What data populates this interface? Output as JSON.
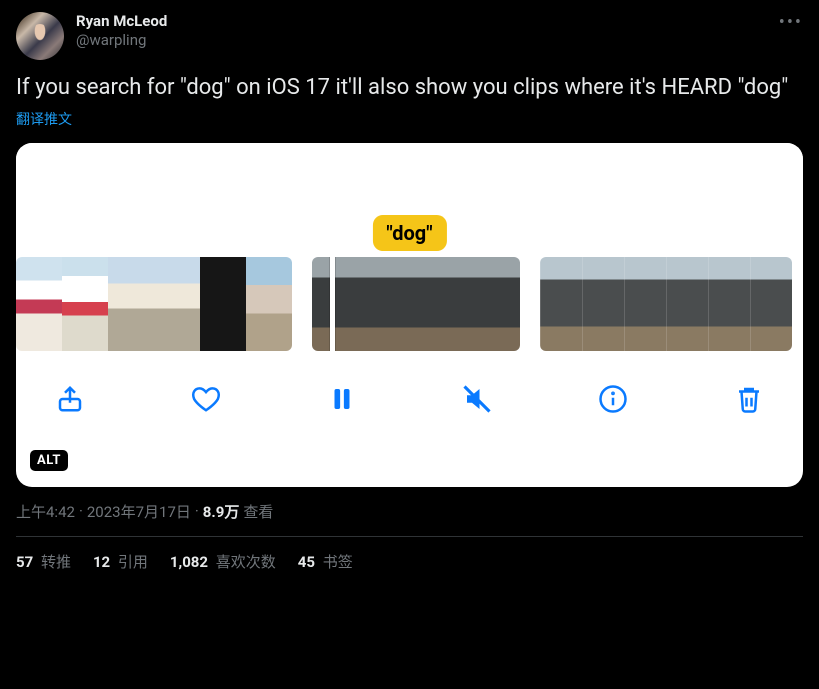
{
  "author": {
    "display_name": "Ryan McLeod",
    "handle": "@warpling"
  },
  "text": "If you search for \"dog\" on iOS 17 it'll also show you clips where it's HEARD \"dog\"",
  "translate_label": "翻译推文",
  "media": {
    "caption_badge": "\"dog\"",
    "alt_badge": "ALT"
  },
  "meta": {
    "time": "上午4:42",
    "sep": " · ",
    "date": "2023年7月17日",
    "views_count": "8.9万",
    "views_label": " 查看"
  },
  "stats": {
    "retweets": {
      "count": "57",
      "label": " 转推"
    },
    "quotes": {
      "count": "12",
      "label": " 引用"
    },
    "likes": {
      "count": "1,082",
      "label": " 喜欢次数"
    },
    "bookmarks": {
      "count": "45",
      "label": " 书签"
    }
  },
  "more_glyph": "•••"
}
